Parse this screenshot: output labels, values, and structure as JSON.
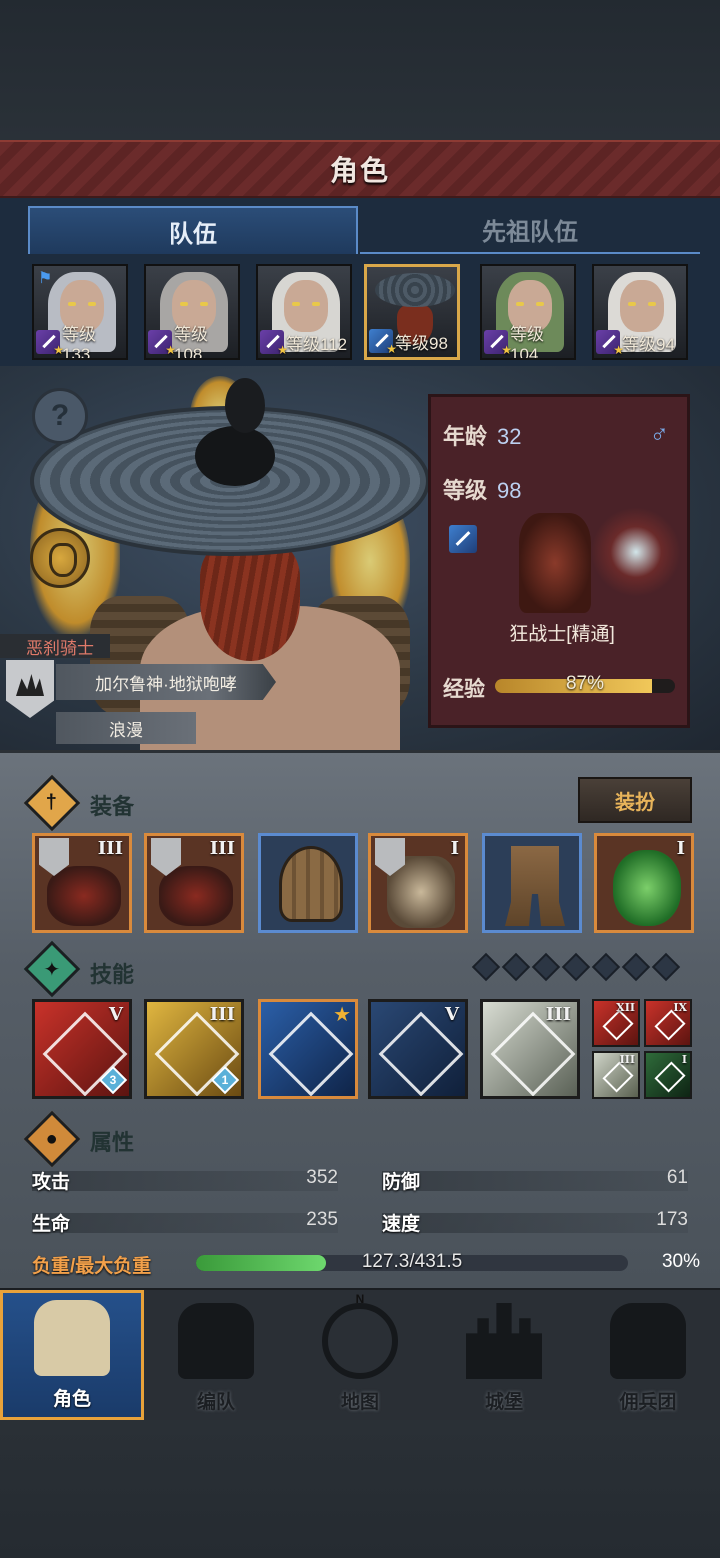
{
  "header": {
    "title": "角色"
  },
  "tabs": [
    {
      "label": "队伍",
      "active": true
    },
    {
      "label": "先祖队伍",
      "active": false
    }
  ],
  "roster": [
    {
      "level_text": "等级133",
      "class": "purple",
      "hair": "#b8bcc4",
      "flag": true
    },
    {
      "level_text": "等级108",
      "class": "purple",
      "hair": "#a8a6a4"
    },
    {
      "level_text": "等级112",
      "class": "purple",
      "hair": "#d7d6d2"
    },
    {
      "level_text": "等级98",
      "class": "blue",
      "hair": "hat",
      "selected": true
    },
    {
      "level_text": "等级104",
      "class": "purple",
      "hair": "#6d8a5a"
    },
    {
      "level_text": "等级94",
      "class": "purple",
      "hair": "#dcdad6"
    }
  ],
  "hero": {
    "title": "恶刹骑士",
    "trait_1": "加尔鲁神·地狱咆哮",
    "trait_2": "浪漫",
    "help_symbol": "?"
  },
  "info": {
    "age_label": "年龄",
    "age_value": "32",
    "level_label": "等级",
    "level_value": "98",
    "gender_symbol": "♂",
    "class_name": "狂战士[精通]",
    "xp_label": "经验",
    "xp_text": "87%",
    "xp_fraction": 0.87
  },
  "equipment": {
    "title": "装备",
    "dress_button": "装扮",
    "slots": [
      {
        "type": "weapon",
        "tier": "III",
        "rarity": "orange",
        "emblem": true
      },
      {
        "type": "weapon",
        "tier": "III",
        "rarity": "orange",
        "emblem": true
      },
      {
        "type": "helm",
        "tier": "",
        "rarity": "blue",
        "emblem": false
      },
      {
        "type": "armor",
        "tier": "I",
        "rarity": "orange",
        "emblem": true
      },
      {
        "type": "boots",
        "tier": "",
        "rarity": "blue",
        "emblem": false
      },
      {
        "type": "jade",
        "tier": "I",
        "rarity": "orange",
        "emblem": false
      }
    ]
  },
  "skills": {
    "title": "技能",
    "slot_count": 7,
    "items": [
      {
        "style": "red",
        "tier": "V",
        "badge": "3"
      },
      {
        "style": "gold",
        "tier": "III",
        "badge": "1"
      },
      {
        "style": "blueb",
        "tier": "",
        "star": true
      },
      {
        "style": "navy",
        "tier": "V"
      },
      {
        "style": "pale",
        "tier": "III"
      }
    ],
    "mini": [
      {
        "style": "r",
        "tier": "XII"
      },
      {
        "style": "r",
        "tier": "IX"
      },
      {
        "style": "g",
        "tier": "III"
      },
      {
        "style": "gr",
        "tier": "I"
      }
    ]
  },
  "attributes": {
    "title": "属性",
    "attack_label": "攻击",
    "attack_value": "352",
    "defense_label": "防御",
    "defense_value": "61",
    "hp_label": "生命",
    "hp_value": "235",
    "speed_label": "速度",
    "speed_value": "173",
    "load_label": "负重/最大负重",
    "load_text": "127.3/431.5",
    "load_pct": "30%",
    "load_fraction": 0.3
  },
  "nav": [
    {
      "label": "角色",
      "icon": "knight-icon",
      "active": true
    },
    {
      "label": "编队",
      "icon": "helmet-icon"
    },
    {
      "label": "地图",
      "icon": "compass-map-icon"
    },
    {
      "label": "城堡",
      "icon": "castle-icon"
    },
    {
      "label": "佣兵团",
      "icon": "mercenary-icon"
    }
  ],
  "colors": {
    "accent": "#e8a23a",
    "panel_red": "#4a2228",
    "tab_blue": "#2b4d78"
  }
}
